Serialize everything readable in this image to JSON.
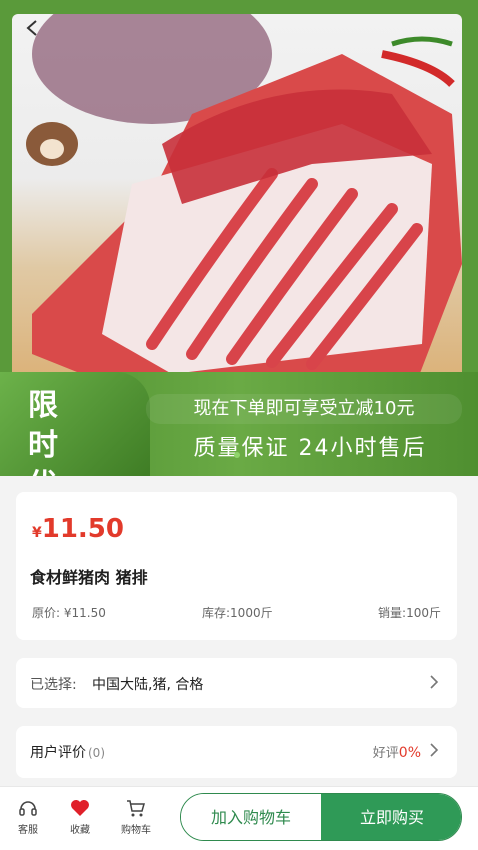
{
  "promo": {
    "tag": "限 时 优 惠",
    "line1": "现在下单即可享受立减10元",
    "line2": "质量保证 24小时售后"
  },
  "product": {
    "currency": "¥",
    "price": "11.50",
    "title": "食材鲜猪肉 猪排",
    "original_price": "原价: ¥11.50",
    "stock": "库存:1000斤",
    "sales": "销量:100斤"
  },
  "selection": {
    "label": "已选择:",
    "value": "中国大陆,猪, 合格"
  },
  "reviews": {
    "label": "用户评价",
    "count": "(0)",
    "good_label": "好评",
    "good_pct": "0%"
  },
  "bottom": {
    "service": "客服",
    "favorite": "收藏",
    "cart": "购物车",
    "add_to_cart": "加入购物车",
    "buy_now": "立即购买"
  },
  "colors": {
    "accent_green": "#2f9a57",
    "price_red": "#e23a2b",
    "promo_green": "#5a9a3a"
  },
  "icons": [
    "back-arrow-icon",
    "headset-icon",
    "heart-icon",
    "cart-icon",
    "chevron-right-icon"
  ]
}
